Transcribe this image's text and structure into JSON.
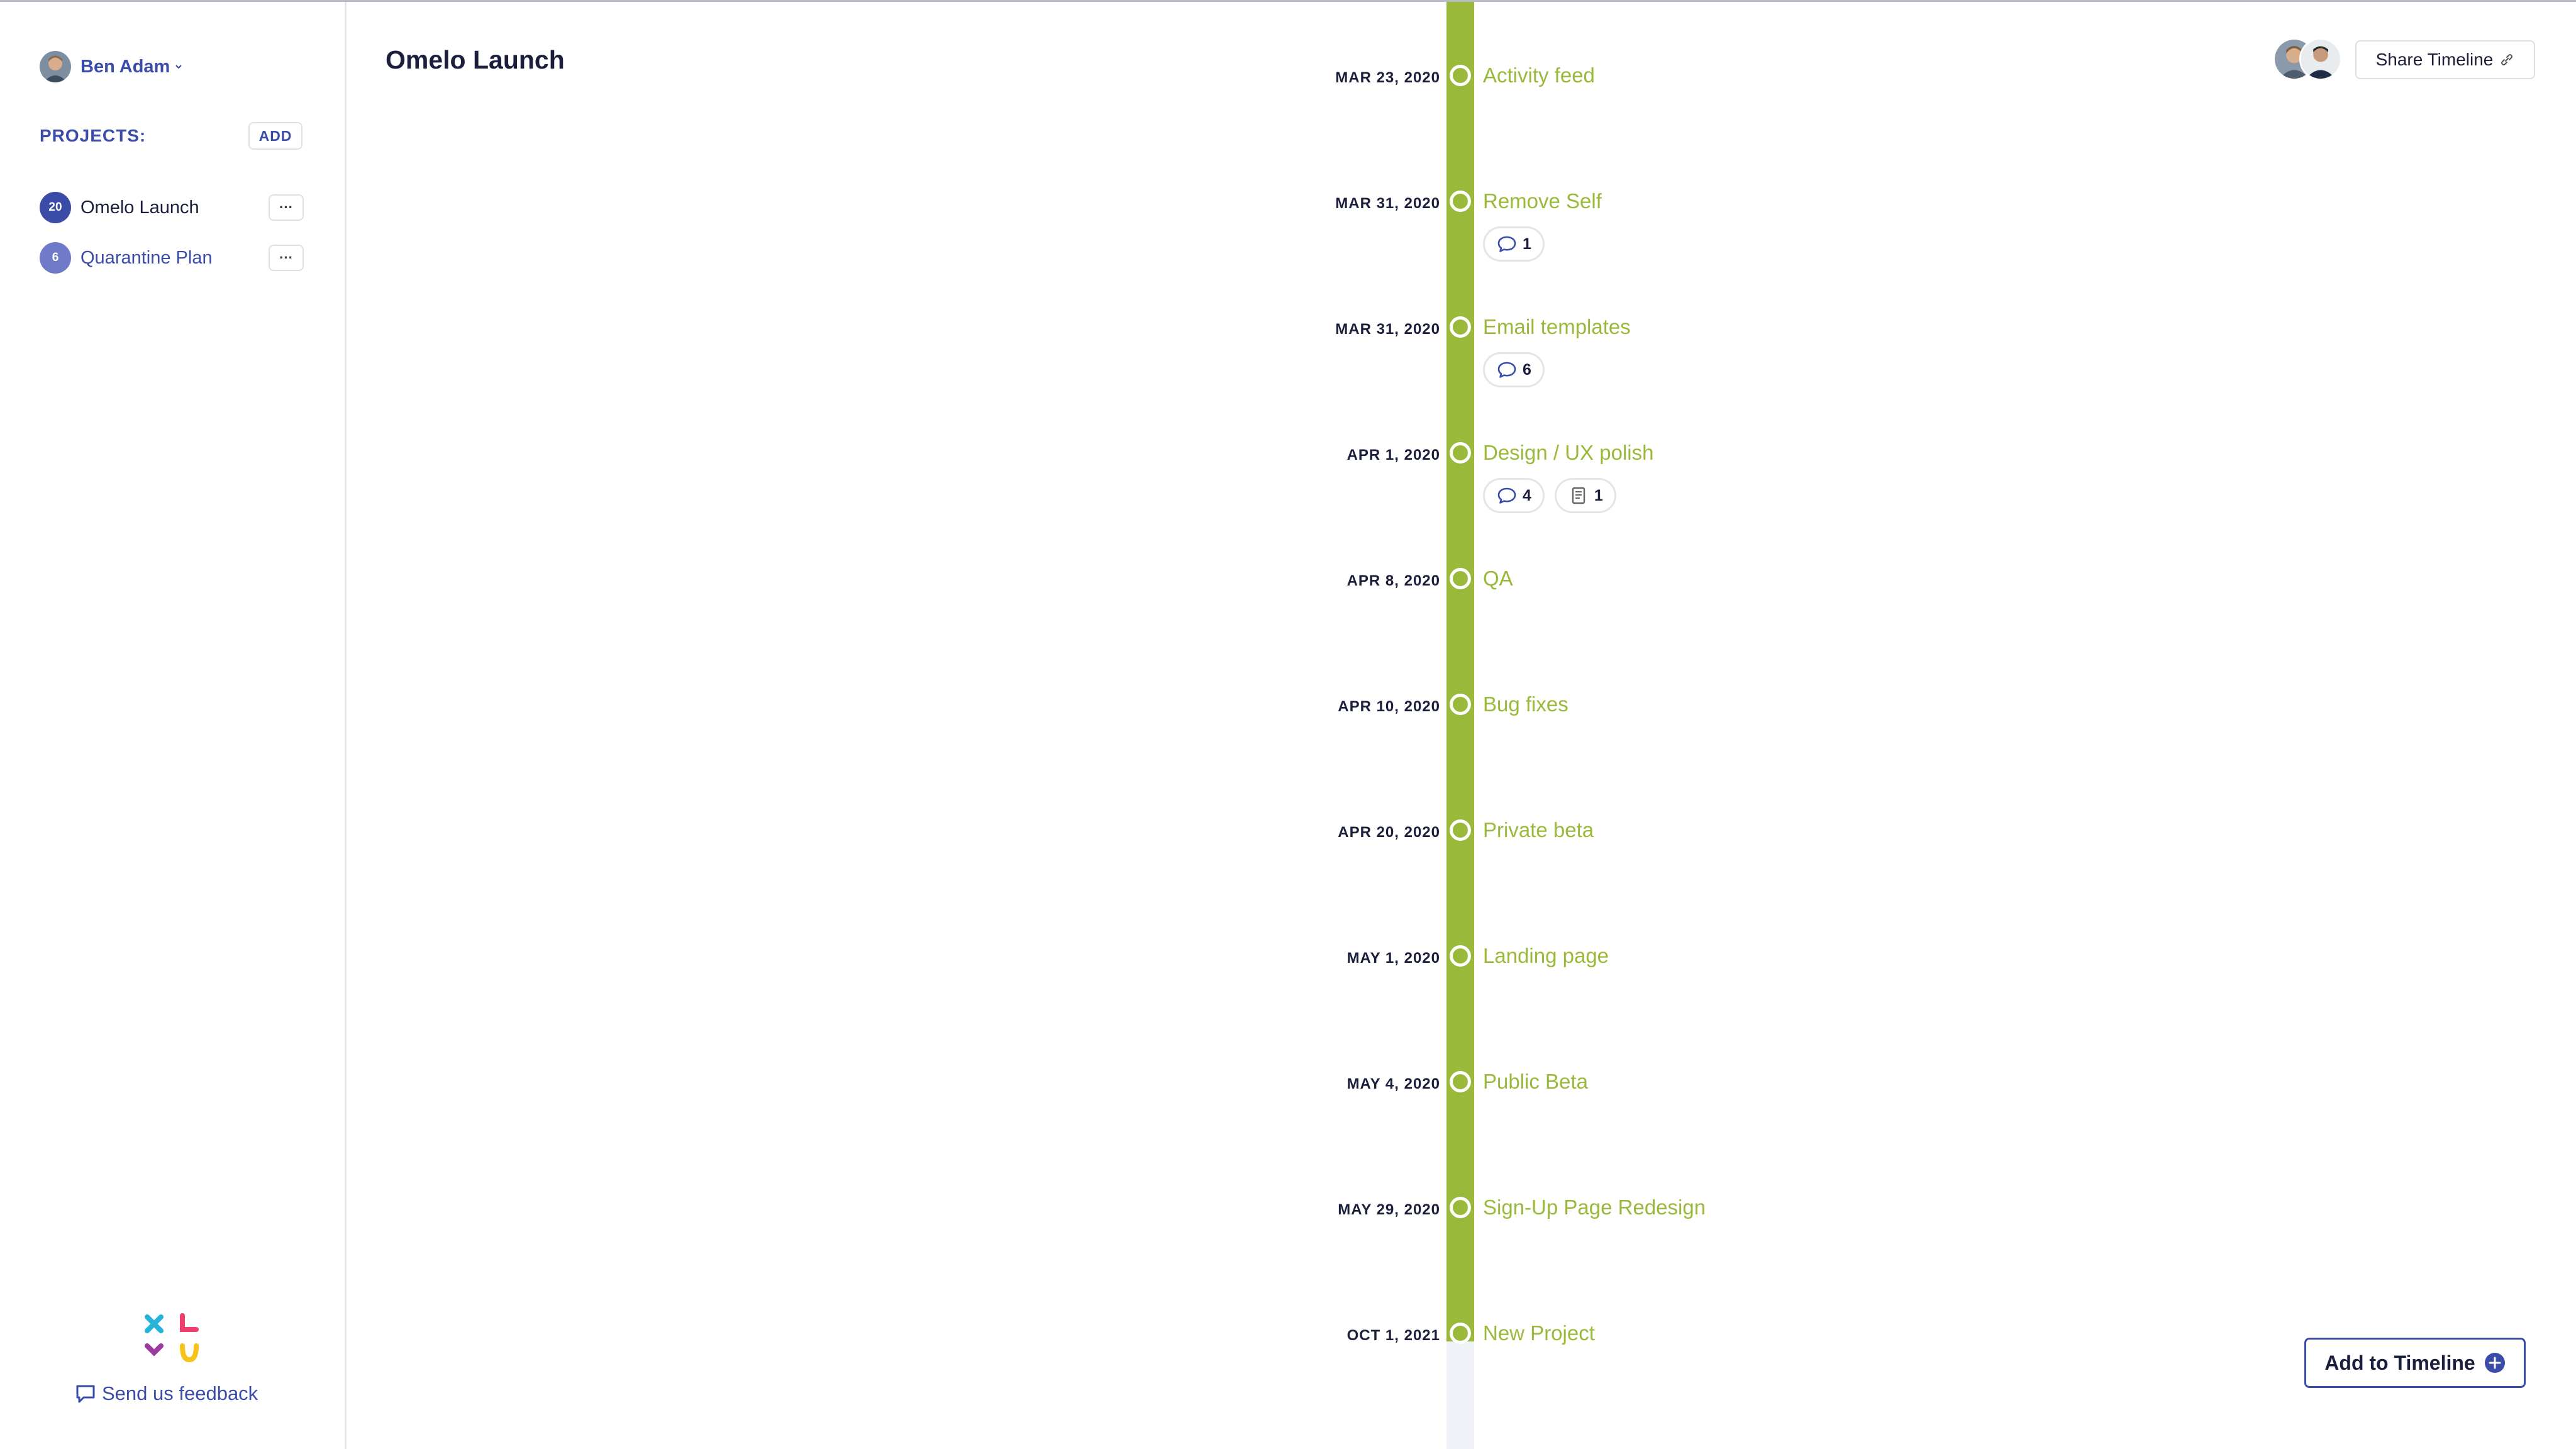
{
  "sidebar": {
    "user_name": "Ben Adam",
    "projects_heading": "PROJECTS:",
    "add_label": "ADD",
    "projects": [
      {
        "count": "20",
        "name": "Omelo Launch",
        "more": "···",
        "color": "#3a4ba8"
      },
      {
        "count": "6",
        "name": "Quarantine Plan",
        "more": "···",
        "color": "#6f7bc9"
      }
    ],
    "feedback_label": "Send us feedback"
  },
  "main": {
    "title": "Omelo Launch",
    "share_label": "Share Timeline",
    "add_label": "Add to Timeline",
    "accent_color": "#9ab93a"
  },
  "timeline": [
    {
      "date": "MAR 23, 2020",
      "title": "Activity feed"
    },
    {
      "date": "MAR 31, 2020",
      "title": "Remove Self",
      "comments": "1"
    },
    {
      "date": "MAR 31, 2020",
      "title": "Email templates",
      "comments": "6"
    },
    {
      "date": "APR 1, 2020",
      "title": "Design / UX polish",
      "comments": "4",
      "docs": "1"
    },
    {
      "date": "APR 8, 2020",
      "title": "QA"
    },
    {
      "date": "APR 10, 2020",
      "title": "Bug fixes"
    },
    {
      "date": "APR 20, 2020",
      "title": "Private beta"
    },
    {
      "date": "MAY 1, 2020",
      "title": "Landing page"
    },
    {
      "date": "MAY 4, 2020",
      "title": "Public Beta"
    },
    {
      "date": "MAY 29, 2020",
      "title": "Sign-Up Page Redesign"
    },
    {
      "date": "OCT 1, 2021",
      "title": "New Project"
    }
  ]
}
